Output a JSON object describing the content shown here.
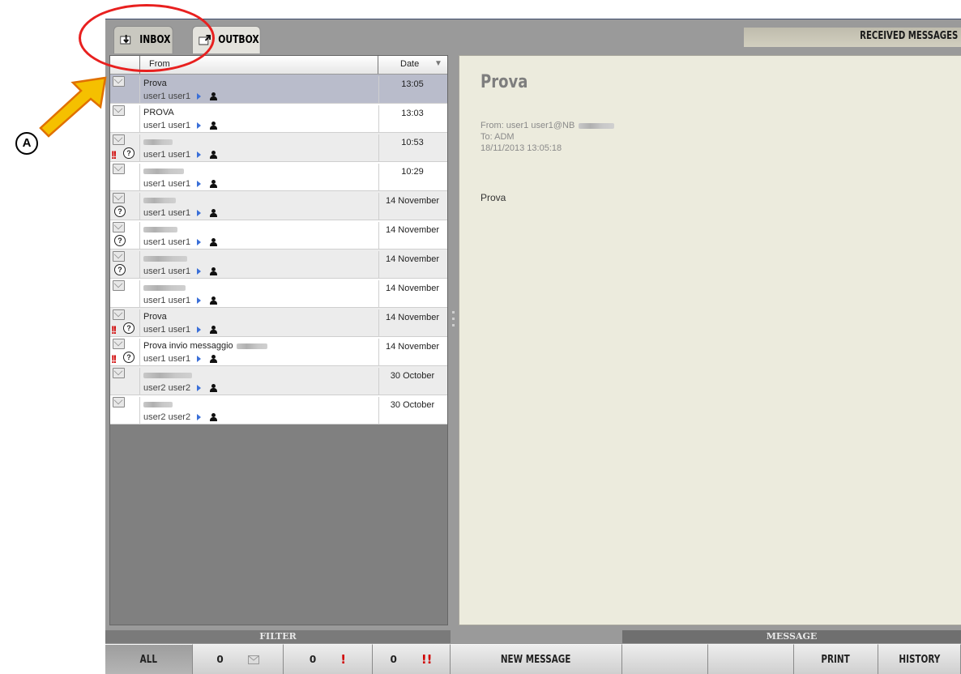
{
  "annotation": {
    "letter": "A"
  },
  "tabs": [
    {
      "label": "INBOX",
      "active": true,
      "icon": "inbox-envelope-icon"
    },
    {
      "label": "OUTBOX",
      "active": false,
      "icon": "outbox-envelope-icon"
    }
  ],
  "header": {
    "title": "RECEIVED MESSAGES"
  },
  "list": {
    "columns": {
      "from": "From",
      "date": "Date"
    },
    "rows": [
      {
        "subject": "Prova",
        "from": "user1 user1",
        "date": "13:05",
        "urgent": false,
        "question": false,
        "selected": true,
        "blurred": false
      },
      {
        "subject": "PROVA",
        "from": "user1 user1",
        "date": "13:03",
        "urgent": false,
        "question": false,
        "selected": false,
        "blurred": false
      },
      {
        "subject": "",
        "from": "user1 user1",
        "date": "10:53",
        "urgent": true,
        "question": true,
        "selected": false,
        "blurred": true
      },
      {
        "subject": "",
        "from": "user1 user1",
        "date": "10:29",
        "urgent": false,
        "question": false,
        "selected": false,
        "blurred": true
      },
      {
        "subject": "",
        "from": "user1 user1",
        "date": "14 November",
        "urgent": false,
        "question": true,
        "selected": false,
        "blurred": true
      },
      {
        "subject": "",
        "from": "user1 user1",
        "date": "14 November",
        "urgent": false,
        "question": true,
        "selected": false,
        "blurred": true
      },
      {
        "subject": "",
        "from": "user1 user1",
        "date": "14 November",
        "urgent": false,
        "question": true,
        "selected": false,
        "blurred": true
      },
      {
        "subject": "",
        "from": "user1 user1",
        "date": "14 November",
        "urgent": false,
        "question": false,
        "selected": false,
        "blurred": true
      },
      {
        "subject": "Prova",
        "from": "user1 user1",
        "date": "14 November",
        "urgent": true,
        "question": true,
        "selected": false,
        "blurred": false
      },
      {
        "subject": "Prova invio messaggio",
        "from": "user1 user1",
        "date": "14 November",
        "urgent": true,
        "question": true,
        "selected": false,
        "blurred": true
      },
      {
        "subject": "",
        "from": "user2 user2",
        "date": "30 October",
        "urgent": false,
        "question": false,
        "selected": false,
        "blurred": true
      },
      {
        "subject": "",
        "from": "user2 user2",
        "date": "30 October",
        "urgent": false,
        "question": false,
        "selected": false,
        "blurred": true
      }
    ]
  },
  "message": {
    "title": "Prova",
    "from": "From: user1 user1@NB",
    "to": "To: ADM",
    "datetime": "18/11/2013 13:05:18",
    "body": "Prova"
  },
  "footer": {
    "filter_label": "FILTER",
    "message_label": "MESSAGE",
    "all_label": "ALL",
    "count_mail": "0",
    "count_important": "0",
    "count_urgent": "0",
    "new_message_label": "NEW MESSAGE",
    "print_label": "PRINT",
    "history_label": "HISTORY"
  },
  "colors": {
    "accent_red": "#d00000",
    "selection": "#b9bccb",
    "pane_bg": "#ecebdd",
    "highlight_ellipse": "#e8201f",
    "arrow": "#f5c000"
  }
}
